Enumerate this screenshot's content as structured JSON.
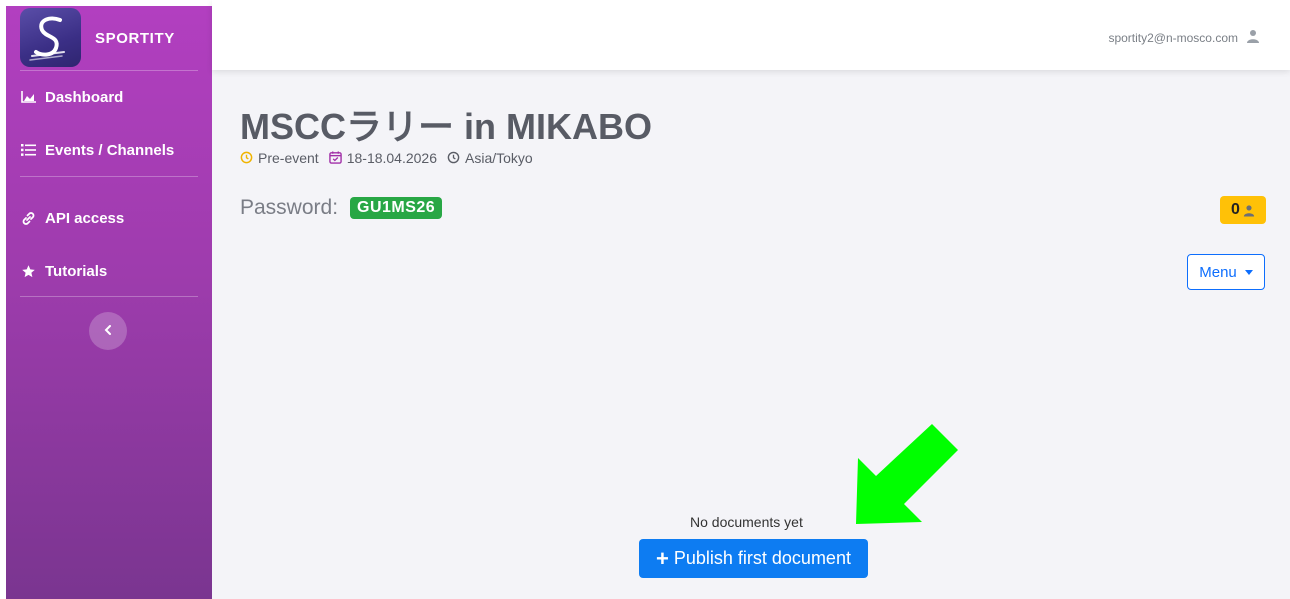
{
  "brand": {
    "name": "SPORTITY"
  },
  "sidebar": {
    "items": [
      {
        "label": "Dashboard",
        "icon": "chart-area-icon"
      },
      {
        "label": "Events / Channels",
        "icon": "list-icon"
      },
      {
        "label": "API access",
        "icon": "link-icon"
      },
      {
        "label": "Tutorials",
        "icon": "star-icon"
      }
    ]
  },
  "topbar": {
    "email": "sportity2@n-mosco.com"
  },
  "event": {
    "title": "MSCCラリー in MIKABO",
    "status": "Pre-event",
    "dates": "18-18.04.2026",
    "timezone": "Asia/Tokyo",
    "password_label": "Password:",
    "password": "GU1MS26",
    "member_count": "0"
  },
  "actions": {
    "menu_label": "Menu"
  },
  "documents": {
    "empty_text": "No documents yet",
    "publish_label": "Publish first document"
  },
  "colors": {
    "annotation_arrow": "#00ff00",
    "accent": "#0d7cf2"
  }
}
